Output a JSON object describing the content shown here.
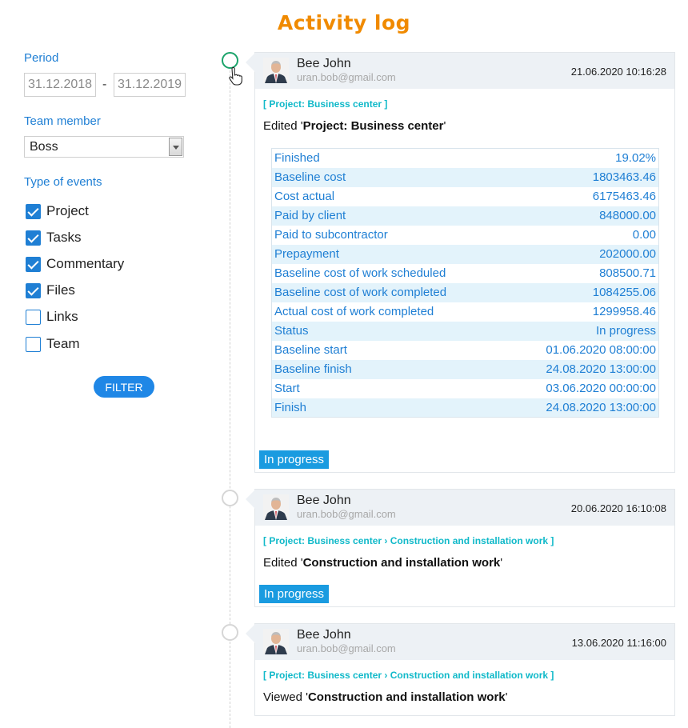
{
  "page": {
    "title": "Activity log"
  },
  "filters": {
    "period_label": "Period",
    "date_from": "31.12.2018",
    "date_separator": "-",
    "date_to": "31.12.2019",
    "team_member_label": "Team member",
    "team_member_value": "Boss",
    "event_types_label": "Type of events",
    "event_types": [
      {
        "label": "Project",
        "checked": true
      },
      {
        "label": "Tasks",
        "checked": true
      },
      {
        "label": "Commentary",
        "checked": true
      },
      {
        "label": "Files",
        "checked": true
      },
      {
        "label": "Links",
        "checked": false
      },
      {
        "label": "Team",
        "checked": false
      }
    ],
    "filter_button": "FILTER"
  },
  "entries": [
    {
      "user": "Bee John",
      "email": "uran.bob@gmail.com",
      "timestamp": "21.06.2020 10:16:28",
      "project_path": "[ Project: Business center ]",
      "action_verb": "Edited '",
      "action_target": "Project: Business center",
      "action_end": "'",
      "details": [
        {
          "label": "Finished",
          "value": "19.02%"
        },
        {
          "label": "Baseline cost",
          "value": "1803463.46"
        },
        {
          "label": "Cost actual",
          "value": "6175463.46"
        },
        {
          "label": "Paid by client",
          "value": "848000.00"
        },
        {
          "label": "Paid to subcontractor",
          "value": "0.00"
        },
        {
          "label": "Prepayment",
          "value": "202000.00"
        },
        {
          "label": "Baseline cost of work scheduled",
          "value": "808500.71"
        },
        {
          "label": "Baseline cost of work completed",
          "value": "1084255.06"
        },
        {
          "label": "Actual cost of work completed",
          "value": "1299958.46"
        },
        {
          "label": "Status",
          "value": "In progress"
        },
        {
          "label": "Baseline start",
          "value": "01.06.2020 08:00:00"
        },
        {
          "label": "Baseline finish",
          "value": "24.08.2020 13:00:00"
        },
        {
          "label": "Start",
          "value": "03.06.2020 00:00:00"
        },
        {
          "label": "Finish",
          "value": "24.08.2020 13:00:00"
        }
      ],
      "status": "In progress"
    },
    {
      "user": "Bee John",
      "email": "uran.bob@gmail.com",
      "timestamp": "20.06.2020 16:10:08",
      "project_path": "[ Project: Business center › Construction and installation work ]",
      "action_verb": "Edited '",
      "action_target": "Construction and installation work",
      "action_end": "'",
      "status": "In progress"
    },
    {
      "user": "Bee John",
      "email": "uran.bob@gmail.com",
      "timestamp": "13.06.2020 11:16:00",
      "project_path": "[ Project: Business center › Construction and installation work ]",
      "action_verb": "Viewed '",
      "action_target": "Construction and installation work",
      "action_end": "'"
    }
  ],
  "colors": {
    "title": "#f08a00",
    "accent": "#1f7fd4",
    "project_link": "#10b9c9",
    "status_badge": "#1a9be0",
    "active_dot": "#1aa36a"
  }
}
